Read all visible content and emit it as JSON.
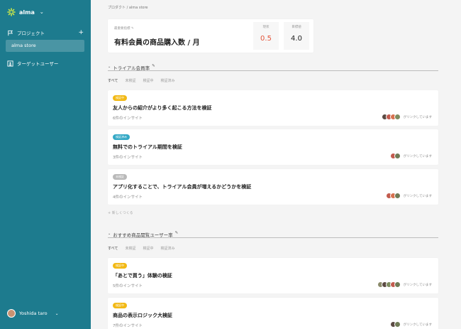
{
  "sidebar": {
    "brand": "alma",
    "projects_label": "プロジェクト",
    "project_item": "alma store",
    "target_users": "ターゲットユーザー",
    "user_name": "Yoshida taro"
  },
  "breadcrumb": "プロダクト / alma store",
  "kpi": {
    "label": "最重要指標",
    "title": "有料会員の商品購入数 / 月",
    "current_label": "現状",
    "current_value": "0.5",
    "goal_label": "目標値",
    "goal_value": "4.0"
  },
  "sections": [
    {
      "title": "トライアル会員率",
      "filters": [
        "すべて",
        "未検証",
        "検証中",
        "検証済み"
      ],
      "cards": [
        {
          "badge": "検証中",
          "title": "友人からの紹介がより多く起こる方法を検証",
          "insights": "6件のインサイト",
          "links": "がリンクしています"
        },
        {
          "badge": "検証済み",
          "title": "無料でのトライアル期間を検証",
          "insights": "3件のインサイト",
          "links": "がリンクしています"
        },
        {
          "badge": "未検証",
          "title": "アプリ化することで、トライアル会員が増えるかどうかを検証",
          "insights": "4件のインサイト",
          "links": "がリンクしています"
        }
      ],
      "new_link": "+ 新しくつくる"
    },
    {
      "title": "おすすめ商品閲覧ユーザー率",
      "filters": [
        "すべて",
        "未検証",
        "検証中",
        "検証済み"
      ],
      "cards": [
        {
          "badge": "検証中",
          "title": "「あとで買う」体験の検証",
          "insights": "5件のインサイト",
          "links": "がリンクしています"
        },
        {
          "badge": "検証中",
          "title": "商品の表示ロジック大検証",
          "insights": "7件のインサイト",
          "links": "がリンクしています"
        }
      ]
    }
  ],
  "colors": {
    "sidebar": "#1d7b8e",
    "in_progress": "#f2b915",
    "verified": "#35a9c6",
    "unverified": "#b9b9b9",
    "current_value": "#e4553b"
  }
}
